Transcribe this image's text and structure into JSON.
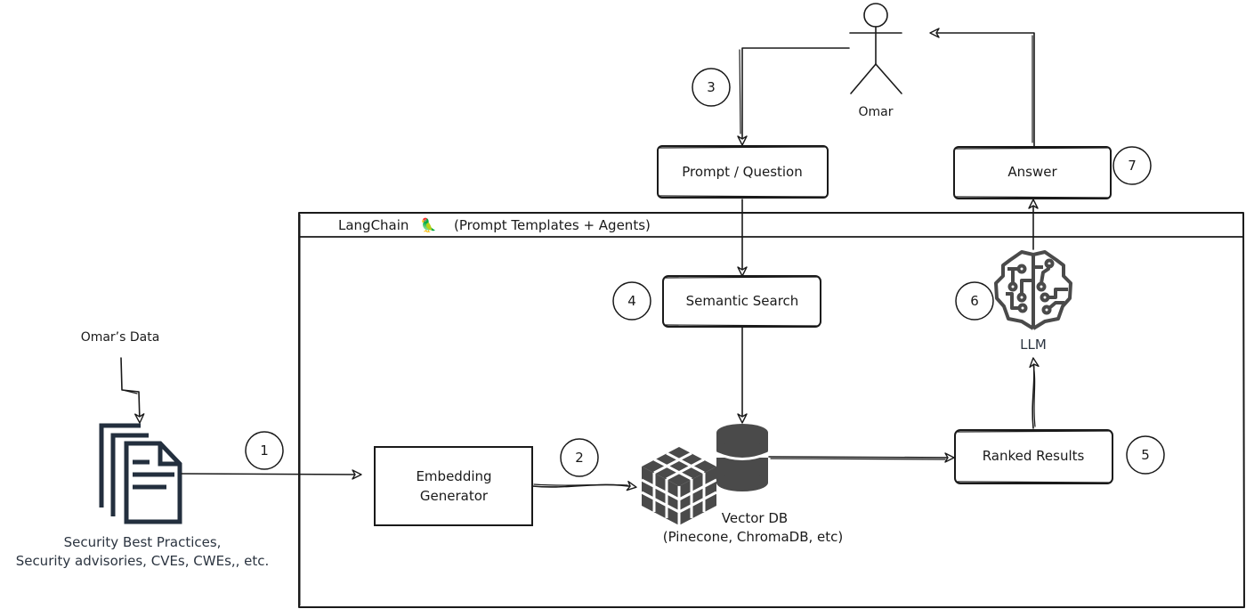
{
  "frame": {
    "title": "LangChain",
    "subtitle": "(Prompt Templates + Agents)",
    "emoji": "🦜"
  },
  "actor": {
    "name": "Omar"
  },
  "data_source": {
    "title": "Omar’s Data",
    "caption_line1": "Security Best Practices,",
    "caption_line2": "Security advisories, CVEs, CWEs,, etc."
  },
  "nodes": {
    "prompt": "Prompt / Question",
    "answer": "Answer",
    "semantic_search": "Semantic Search",
    "embedding_line1": "Embedding",
    "embedding_line2": "Generator",
    "vector_db_line1": "Vector DB",
    "vector_db_line2": "(Pinecone, ChromaDB, etc)",
    "ranked_results": "Ranked Results",
    "llm": "LLM"
  },
  "steps": {
    "s1": "1",
    "s2": "2",
    "s3": "3",
    "s4": "4",
    "s5": "5",
    "s6": "6",
    "s7": "7"
  },
  "colors": {
    "ink": "#1a1a1a",
    "doc_icon": "#232f3e",
    "db_icon": "#4a4a4a",
    "brain_icon": "#4a4a4a"
  }
}
